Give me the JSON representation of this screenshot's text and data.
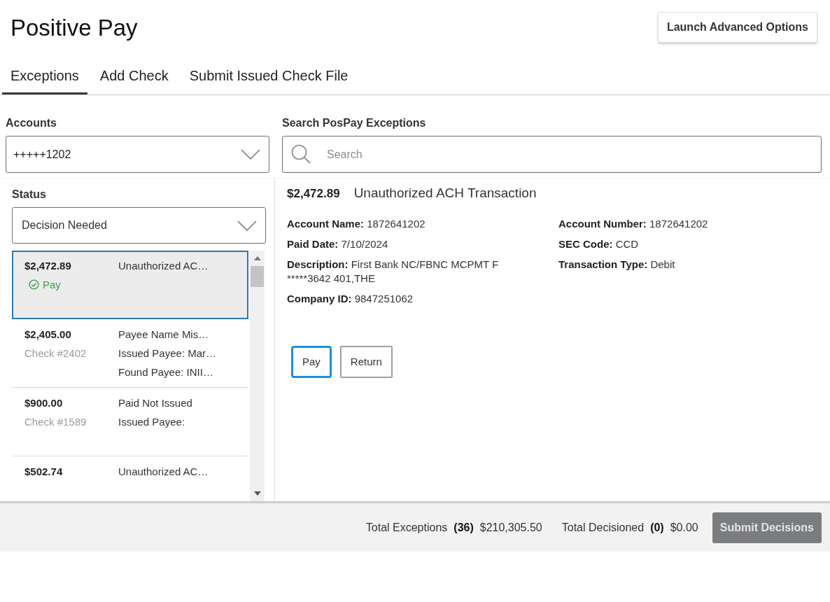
{
  "header": {
    "title": "Positive Pay",
    "advanced_button": "Launch Advanced Options"
  },
  "tabs": [
    {
      "label": "Exceptions",
      "selected": true
    },
    {
      "label": "Add Check",
      "selected": false
    },
    {
      "label": "Submit Issued Check File",
      "selected": false
    }
  ],
  "accounts": {
    "label": "Accounts",
    "value": "+++++1202"
  },
  "search": {
    "label": "Search PosPay Exceptions",
    "placeholder": "Search"
  },
  "status_filter": {
    "label": "Status",
    "value": "Decision Needed"
  },
  "exceptions": [
    {
      "amount": "$2,472.89",
      "decision": "Pay",
      "lines": [
        "Unauthorized AC…"
      ],
      "selected": true
    },
    {
      "amount": "$2,405.00",
      "check": "Check #2402",
      "lines": [
        "Payee Name Mis…",
        "Issued Payee: Mar…",
        "Found Payee: INII…"
      ],
      "selected": false
    },
    {
      "amount": "$900.00",
      "check": "Check #1589",
      "lines": [
        "Paid Not Issued",
        "Issued Payee:"
      ],
      "selected": false
    },
    {
      "amount": "$502.74",
      "lines": [
        "Unauthorized AC…"
      ],
      "selected": false
    }
  ],
  "detail": {
    "amount": "$2,472.89",
    "type": "Unauthorized ACH Transaction",
    "fields_left": [
      {
        "label": "Account Name:",
        "value": "1872641202"
      },
      {
        "label": "Paid Date:",
        "value": "7/10/2024"
      },
      {
        "label": "Description:",
        "value": "First Bank NC/FBNC MCPMT F *****3642 401,THE"
      },
      {
        "label": "Company ID:",
        "value": "9847251062"
      }
    ],
    "fields_right": [
      {
        "label": "Account Number:",
        "value": "1872641202"
      },
      {
        "label": "SEC Code:",
        "value": "CCD"
      },
      {
        "label": "Transaction Type:",
        "value": "Debit"
      }
    ],
    "actions": [
      {
        "label": "Pay",
        "focused": true
      },
      {
        "label": "Return",
        "focused": false
      }
    ]
  },
  "footer": {
    "totals": [
      {
        "label": "Total Exceptions",
        "count": "(36)",
        "amount": "$210,305.50"
      },
      {
        "label": "Total Decisioned",
        "count": "(0)",
        "amount": "$0.00"
      }
    ],
    "submit": {
      "label": "Submit Decisions",
      "disabled": true
    }
  }
}
